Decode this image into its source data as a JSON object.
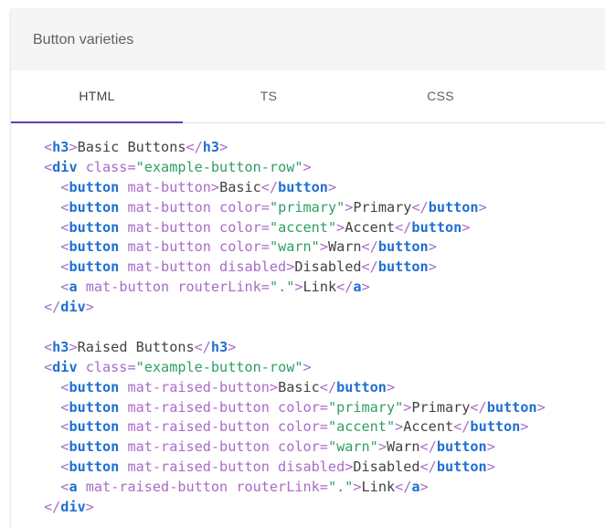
{
  "card": {
    "title": "Button varieties"
  },
  "tabs": [
    {
      "label": "HTML",
      "active": true
    },
    {
      "label": "TS",
      "active": false
    },
    {
      "label": "CSS",
      "active": false
    }
  ],
  "accent_color": "#673ab7",
  "code_lines": [
    [
      {
        "c": "p",
        "v": "<"
      },
      {
        "c": "t",
        "v": "h3"
      },
      {
        "c": "p",
        "v": ">"
      },
      {
        "c": "x",
        "v": "Basic Buttons"
      },
      {
        "c": "p",
        "v": "</"
      },
      {
        "c": "t",
        "v": "h3"
      },
      {
        "c": "p",
        "v": ">"
      }
    ],
    [
      {
        "c": "p",
        "v": "<"
      },
      {
        "c": "t",
        "v": "div"
      },
      {
        "c": "a",
        "v": " class"
      },
      {
        "c": "p",
        "v": "="
      },
      {
        "c": "s",
        "v": "\"example-button-row\""
      },
      {
        "c": "p",
        "v": ">"
      }
    ],
    [
      {
        "c": "x",
        "v": "  "
      },
      {
        "c": "p",
        "v": "<"
      },
      {
        "c": "t",
        "v": "button"
      },
      {
        "c": "a",
        "v": " mat-button"
      },
      {
        "c": "p",
        "v": ">"
      },
      {
        "c": "x",
        "v": "Basic"
      },
      {
        "c": "p",
        "v": "</"
      },
      {
        "c": "t",
        "v": "button"
      },
      {
        "c": "p",
        "v": ">"
      }
    ],
    [
      {
        "c": "x",
        "v": "  "
      },
      {
        "c": "p",
        "v": "<"
      },
      {
        "c": "t",
        "v": "button"
      },
      {
        "c": "a",
        "v": " mat-button color"
      },
      {
        "c": "p",
        "v": "="
      },
      {
        "c": "s",
        "v": "\"primary\""
      },
      {
        "c": "p",
        "v": ">"
      },
      {
        "c": "x",
        "v": "Primary"
      },
      {
        "c": "p",
        "v": "</"
      },
      {
        "c": "t",
        "v": "button"
      },
      {
        "c": "p",
        "v": ">"
      }
    ],
    [
      {
        "c": "x",
        "v": "  "
      },
      {
        "c": "p",
        "v": "<"
      },
      {
        "c": "t",
        "v": "button"
      },
      {
        "c": "a",
        "v": " mat-button color"
      },
      {
        "c": "p",
        "v": "="
      },
      {
        "c": "s",
        "v": "\"accent\""
      },
      {
        "c": "p",
        "v": ">"
      },
      {
        "c": "x",
        "v": "Accent"
      },
      {
        "c": "p",
        "v": "</"
      },
      {
        "c": "t",
        "v": "button"
      },
      {
        "c": "p",
        "v": ">"
      }
    ],
    [
      {
        "c": "x",
        "v": "  "
      },
      {
        "c": "p",
        "v": "<"
      },
      {
        "c": "t",
        "v": "button"
      },
      {
        "c": "a",
        "v": " mat-button color"
      },
      {
        "c": "p",
        "v": "="
      },
      {
        "c": "s",
        "v": "\"warn\""
      },
      {
        "c": "p",
        "v": ">"
      },
      {
        "c": "x",
        "v": "Warn"
      },
      {
        "c": "p",
        "v": "</"
      },
      {
        "c": "t",
        "v": "button"
      },
      {
        "c": "p",
        "v": ">"
      }
    ],
    [
      {
        "c": "x",
        "v": "  "
      },
      {
        "c": "p",
        "v": "<"
      },
      {
        "c": "t",
        "v": "button"
      },
      {
        "c": "a",
        "v": " mat-button disabled"
      },
      {
        "c": "p",
        "v": ">"
      },
      {
        "c": "x",
        "v": "Disabled"
      },
      {
        "c": "p",
        "v": "</"
      },
      {
        "c": "t",
        "v": "button"
      },
      {
        "c": "p",
        "v": ">"
      }
    ],
    [
      {
        "c": "x",
        "v": "  "
      },
      {
        "c": "p",
        "v": "<"
      },
      {
        "c": "t",
        "v": "a"
      },
      {
        "c": "a",
        "v": " mat-button routerLink"
      },
      {
        "c": "p",
        "v": "="
      },
      {
        "c": "s",
        "v": "\".\""
      },
      {
        "c": "p",
        "v": ">"
      },
      {
        "c": "x",
        "v": "Link"
      },
      {
        "c": "p",
        "v": "</"
      },
      {
        "c": "t",
        "v": "a"
      },
      {
        "c": "p",
        "v": ">"
      }
    ],
    [
      {
        "c": "p",
        "v": "</"
      },
      {
        "c": "t",
        "v": "div"
      },
      {
        "c": "p",
        "v": ">"
      }
    ],
    [],
    [
      {
        "c": "p",
        "v": "<"
      },
      {
        "c": "t",
        "v": "h3"
      },
      {
        "c": "p",
        "v": ">"
      },
      {
        "c": "x",
        "v": "Raised Buttons"
      },
      {
        "c": "p",
        "v": "</"
      },
      {
        "c": "t",
        "v": "h3"
      },
      {
        "c": "p",
        "v": ">"
      }
    ],
    [
      {
        "c": "p",
        "v": "<"
      },
      {
        "c": "t",
        "v": "div"
      },
      {
        "c": "a",
        "v": " class"
      },
      {
        "c": "p",
        "v": "="
      },
      {
        "c": "s",
        "v": "\"example-button-row\""
      },
      {
        "c": "p",
        "v": ">"
      }
    ],
    [
      {
        "c": "x",
        "v": "  "
      },
      {
        "c": "p",
        "v": "<"
      },
      {
        "c": "t",
        "v": "button"
      },
      {
        "c": "a",
        "v": " mat-raised-button"
      },
      {
        "c": "p",
        "v": ">"
      },
      {
        "c": "x",
        "v": "Basic"
      },
      {
        "c": "p",
        "v": "</"
      },
      {
        "c": "t",
        "v": "button"
      },
      {
        "c": "p",
        "v": ">"
      }
    ],
    [
      {
        "c": "x",
        "v": "  "
      },
      {
        "c": "p",
        "v": "<"
      },
      {
        "c": "t",
        "v": "button"
      },
      {
        "c": "a",
        "v": " mat-raised-button color"
      },
      {
        "c": "p",
        "v": "="
      },
      {
        "c": "s",
        "v": "\"primary\""
      },
      {
        "c": "p",
        "v": ">"
      },
      {
        "c": "x",
        "v": "Primary"
      },
      {
        "c": "p",
        "v": "</"
      },
      {
        "c": "t",
        "v": "button"
      },
      {
        "c": "p",
        "v": ">"
      }
    ],
    [
      {
        "c": "x",
        "v": "  "
      },
      {
        "c": "p",
        "v": "<"
      },
      {
        "c": "t",
        "v": "button"
      },
      {
        "c": "a",
        "v": " mat-raised-button color"
      },
      {
        "c": "p",
        "v": "="
      },
      {
        "c": "s",
        "v": "\"accent\""
      },
      {
        "c": "p",
        "v": ">"
      },
      {
        "c": "x",
        "v": "Accent"
      },
      {
        "c": "p",
        "v": "</"
      },
      {
        "c": "t",
        "v": "button"
      },
      {
        "c": "p",
        "v": ">"
      }
    ],
    [
      {
        "c": "x",
        "v": "  "
      },
      {
        "c": "p",
        "v": "<"
      },
      {
        "c": "t",
        "v": "button"
      },
      {
        "c": "a",
        "v": " mat-raised-button color"
      },
      {
        "c": "p",
        "v": "="
      },
      {
        "c": "s",
        "v": "\"warn\""
      },
      {
        "c": "p",
        "v": ">"
      },
      {
        "c": "x",
        "v": "Warn"
      },
      {
        "c": "p",
        "v": "</"
      },
      {
        "c": "t",
        "v": "button"
      },
      {
        "c": "p",
        "v": ">"
      }
    ],
    [
      {
        "c": "x",
        "v": "  "
      },
      {
        "c": "p",
        "v": "<"
      },
      {
        "c": "t",
        "v": "button"
      },
      {
        "c": "a",
        "v": " mat-raised-button disabled"
      },
      {
        "c": "p",
        "v": ">"
      },
      {
        "c": "x",
        "v": "Disabled"
      },
      {
        "c": "p",
        "v": "</"
      },
      {
        "c": "t",
        "v": "button"
      },
      {
        "c": "p",
        "v": ">"
      }
    ],
    [
      {
        "c": "x",
        "v": "  "
      },
      {
        "c": "p",
        "v": "<"
      },
      {
        "c": "t",
        "v": "a"
      },
      {
        "c": "a",
        "v": " mat-raised-button routerLink"
      },
      {
        "c": "p",
        "v": "="
      },
      {
        "c": "s",
        "v": "\".\""
      },
      {
        "c": "p",
        "v": ">"
      },
      {
        "c": "x",
        "v": "Link"
      },
      {
        "c": "p",
        "v": "</"
      },
      {
        "c": "t",
        "v": "a"
      },
      {
        "c": "p",
        "v": ">"
      }
    ],
    [
      {
        "c": "p",
        "v": "</"
      },
      {
        "c": "t",
        "v": "div"
      },
      {
        "c": "p",
        "v": ">"
      }
    ]
  ]
}
